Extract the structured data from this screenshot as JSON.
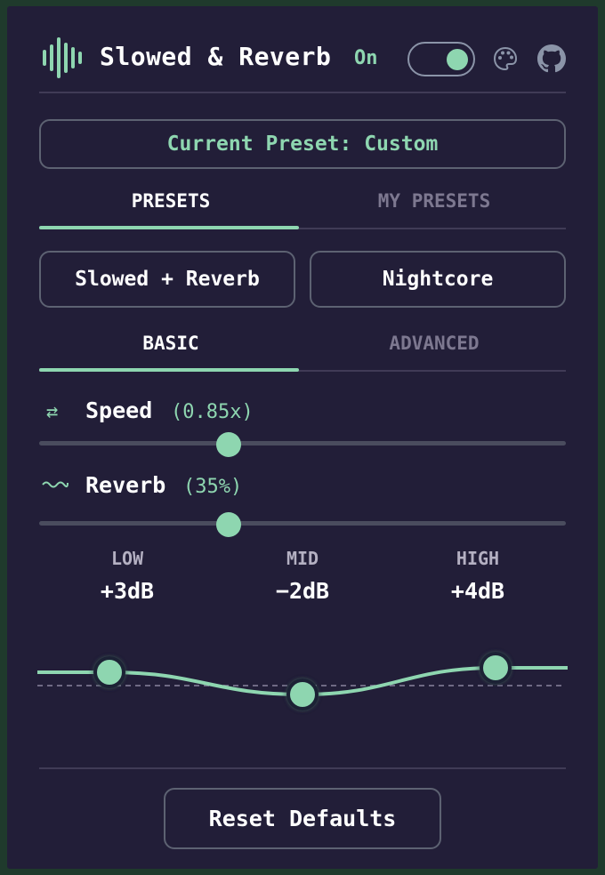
{
  "header": {
    "title": "Slowed & Reverb",
    "status": "On",
    "toggle_on": true,
    "icons": [
      "waveform-logo-icon",
      "palette-icon",
      "github-icon"
    ]
  },
  "preset": {
    "current_label": "Current Preset: Custom"
  },
  "preset_tabs": [
    {
      "label": "PRESETS",
      "active": true
    },
    {
      "label": "MY PRESETS",
      "active": false
    }
  ],
  "preset_buttons": [
    "Slowed + Reverb",
    "Nightcore"
  ],
  "mode_tabs": [
    {
      "label": "BASIC",
      "active": true
    },
    {
      "label": "ADVANCED",
      "active": false
    }
  ],
  "sliders": {
    "speed": {
      "icon": "swap-icon",
      "label": "Speed",
      "value": "(0.85x)",
      "fraction": 0.36
    },
    "reverb": {
      "icon": "wave-icon",
      "label": "Reverb",
      "value": "(35%)",
      "fraction": 0.36
    }
  },
  "eq": {
    "bands": [
      {
        "name": "LOW",
        "value": "+3dB",
        "db": 3
      },
      {
        "name": "MID",
        "value": "−2dB",
        "db": -2
      },
      {
        "name": "HIGH",
        "value": "+4dB",
        "db": 4
      }
    ]
  },
  "footer": {
    "reset_label": "Reset Defaults"
  },
  "colors": {
    "accent": "#8ed6b0",
    "background": "#221e38",
    "frame": "#1f3a2c",
    "border": "#5d6272"
  }
}
